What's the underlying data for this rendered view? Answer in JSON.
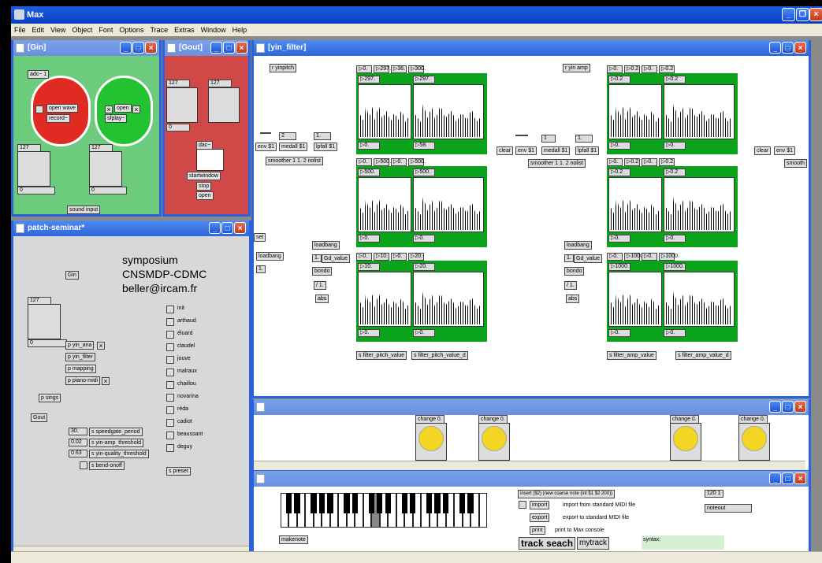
{
  "app": {
    "title": "Max",
    "menu": [
      "File",
      "Edit",
      "View",
      "Object",
      "Font",
      "Options",
      "Trace",
      "Extras",
      "Window",
      "Help"
    ]
  },
  "windows": {
    "gin": {
      "title": "[Gin]",
      "adc": "adc~ 1",
      "open_wave": "open wave",
      "record": "record~",
      "open": "open",
      "sfplay": "sfplay~",
      "sl1": "127",
      "sl2": "127",
      "z1": "0",
      "z2": "0",
      "sound_input": "sound input"
    },
    "gout": {
      "title": "[Gout]",
      "sl1": "127",
      "sl2": "127",
      "z1": "0",
      "dac": "dac~",
      "startwindow": "startwindow",
      "stop": "stop",
      "open": "open"
    },
    "patch": {
      "title": "patch-seminar*",
      "text1": "symposium",
      "text2": "CNSMDP-CDMC",
      "text3": "beller@ircam.fr",
      "gin": "Gin",
      "gout": "Gout",
      "sl": "127",
      "z": "0",
      "yin_ana": "p yin_ana",
      "yin_filter": "p yin_filter",
      "mapping": "p mapping",
      "piano_midi": "p piano-midi",
      "sings": "p sings",
      "presets": [
        "init",
        "arthaud",
        "éluard",
        "claudel",
        "jouve",
        "malraux",
        "chaillou",
        "novarina",
        "réda",
        "cadiot",
        "beaussant",
        "deguy"
      ],
      "spreset": "s preset",
      "params": [
        {
          "val": "30.",
          "name": "s speedgate_period"
        },
        {
          "val": "0.02",
          "name": "s yin-amp_threshold"
        },
        {
          "val": "0.63",
          "name": "s yin-quality_threshold"
        },
        {
          "val": "",
          "name": "s bend-onoff"
        }
      ]
    },
    "yin_filter": {
      "title": "[yin_filter]",
      "left": {
        "recv": "r yinpitch",
        "env": "env $1",
        "medall": "medall $1",
        "lpfall": "lpfall $1",
        "n2": "2",
        "n1": "1.",
        "smoother": "smoother 1 1. 2 nolist",
        "set": "set",
        "loadbang": "loadbang",
        "one": "1.",
        "loadbang2": "loadbang",
        "gd": "Gd_value",
        "bondo": "bondo",
        "div": "/ 1.",
        "abs": "abs",
        "send1": "s filter_pitch_value",
        "send2": "s filter_pitch_value_d",
        "row1": [
          "0.",
          "297.",
          "36.",
          "300."
        ],
        "row1b": [
          "297.",
          "297."
        ],
        "row1c": [
          "0.",
          "58."
        ],
        "row2": [
          "0.",
          "500.",
          "0.",
          "500."
        ],
        "row2b": [
          "500.",
          "500."
        ],
        "row2c": [
          "0.",
          "0."
        ],
        "row3": [
          "0.",
          "10.",
          "0.",
          "20."
        ],
        "row3b": [
          "10.",
          "20."
        ],
        "row3c": [
          "0.",
          "0."
        ]
      },
      "right": {
        "recv": "r yin amp",
        "clear": "clear",
        "env": "env $1",
        "medall": "medall $1",
        "lpfall": "lpfall $1",
        "n1": "1",
        "n2": "1.",
        "smoother": "smoother 1 1. 2 nolist",
        "loadbang": "loadbang",
        "one": "1.",
        "gd": "Gd_value",
        "bondo": "bondo",
        "div": "/ 1.",
        "abs": "abs",
        "send1": "s filter_amp_value",
        "send2": "s filter_amp_value_d",
        "clear2": "clear",
        "env2": "env $1",
        "smooth2": "smooth",
        "row1": [
          "0.",
          "0.2",
          "0.",
          "0.2"
        ],
        "row1b": [
          "0.2",
          "0.2"
        ],
        "row1c": [
          "0.",
          "0."
        ],
        "row2": [
          "0.",
          "0.2",
          "0.",
          "0.2"
        ],
        "row2b": [
          "0.2",
          "0.2"
        ],
        "row2c": [
          "0.",
          "0."
        ],
        "row3": [
          "0.",
          "1000.",
          "0.",
          "1000."
        ],
        "row3b": [
          "1000.",
          "1000."
        ],
        "row3c": [
          "0.",
          "0."
        ]
      }
    },
    "mid": {
      "change": "change 0."
    },
    "bottom": {
      "insert": "insert ($2) (new coarse note (int $1 $2 200))",
      "import": "import",
      "import_desc": "import from standard MIDI file",
      "export": "export",
      "export_desc": "export to standard MIDI file",
      "print": "print",
      "print_desc": "print to Max console",
      "track": "track seach",
      "mytrack": "mytrack",
      "syntax": "syntax:",
      "tempo": "120 1",
      "noteout": "noteout",
      "makenote": "makenote"
    }
  }
}
